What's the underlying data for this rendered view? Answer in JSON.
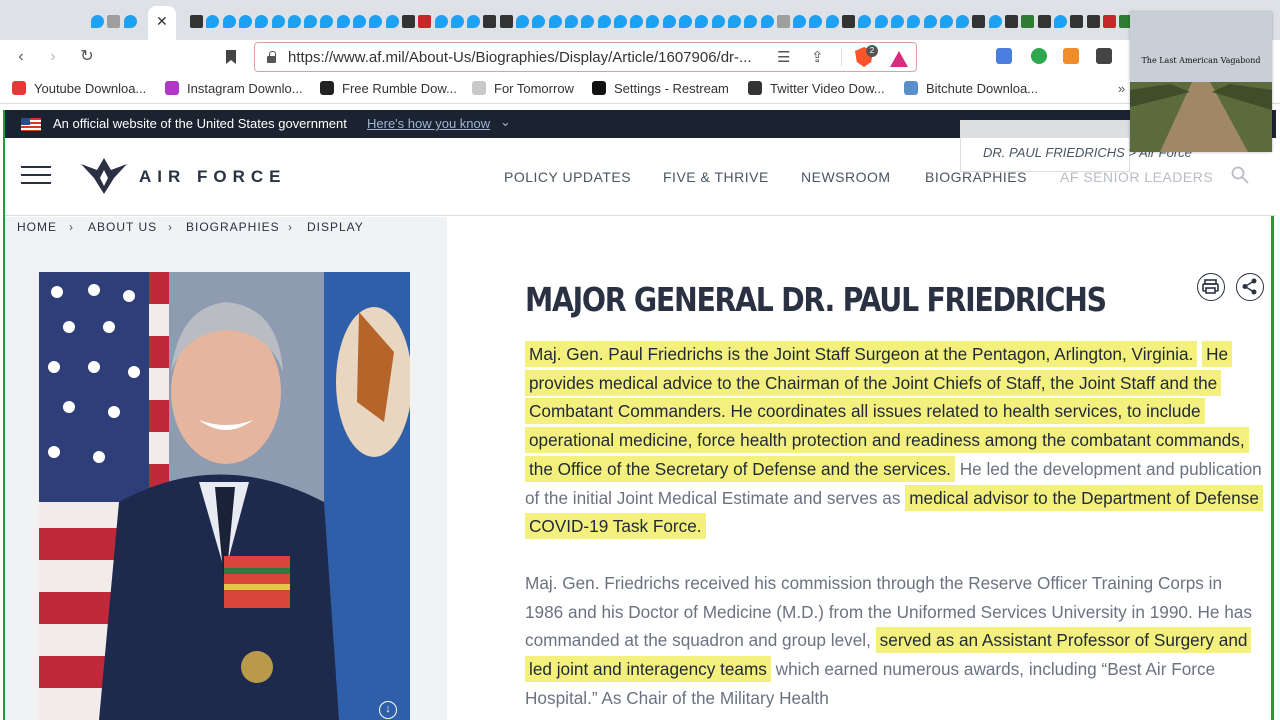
{
  "browser": {
    "active_tab_close": "✕",
    "url": "https://www.af.mil/About-Us/Biographies/Display/Article/1607906/dr-...",
    "brave_badge": "2",
    "bookmarks": [
      {
        "label": "Youtube Downloa...",
        "color": "#e53935"
      },
      {
        "label": "Instagram Downlo...",
        "color": "#b037c8"
      },
      {
        "label": "Free Rumble Dow...",
        "color": "#222222"
      },
      {
        "label": "For Tomorrow",
        "color": "#c9c9c9"
      },
      {
        "label": "Settings - Restream",
        "color": "#111111"
      },
      {
        "label": "Twitter Video Dow...",
        "color": "#333333"
      },
      {
        "label": "Bitchute Downloa...",
        "color": "#5a8fc9"
      }
    ],
    "more_bookmarks": "»"
  },
  "gov_banner": {
    "text": "An official website of the United States government",
    "link": "Here's how you know"
  },
  "header": {
    "brand": "AIR FORCE",
    "nav": [
      "POLICY UPDATES",
      "FIVE & THRIVE",
      "NEWSROOM",
      "BIOGRAPHIES",
      "AF SENIOR LEADERS"
    ]
  },
  "breadcrumb": [
    "HOME",
    "ABOUT US",
    "BIOGRAPHIES",
    "DISPLAY"
  ],
  "article": {
    "title": "MAJOR GENERAL DR. PAUL FRIEDRICHS",
    "p1_hl1": "Maj. Gen. Paul Friedrichs is the Joint Staff Surgeon at the Pentagon, Arlington, Virginia.",
    "p1_hl2": "He provides medical advice to the Chairman of the Joint Chiefs of Staff, the Joint Staff and the Combatant Commanders. He coordinates all issues related to health services, to include operational medicine, force health protection and readiness among the combatant commands, the Office of the Secretary of Defense and the services.",
    "p1_plain": " He led the development and publication of the initial Joint Medical Estimate and serves as ",
    "p1_hl3": "medical advisor to the Department of Defense COVID-19 Task Force.",
    "p2_plain1": "Maj. Gen. Friedrichs received his commission through the Reserve Officer Training Corps in 1986 and his Doctor of Medicine (M.D.) from the Uniformed Services University in 1990. He has commanded at the squadron and group level, ",
    "p2_hl": "served as an Assistant Professor of Surgery and led joint and interagency teams",
    "p2_plain2": " which earned numerous awards, including “Best Air Force Hospital.” As Chair of the Military Health"
  },
  "overlay": {
    "title": "The Last American Vagabond",
    "tooltip": "DR. PAUL FRIEDRICHS > Air Force"
  },
  "colors": {
    "highlight": "#f4f07e",
    "gov_banner": "#1b2330",
    "text_dark": "#2a3142",
    "frame_green": "#1f9d3b"
  }
}
